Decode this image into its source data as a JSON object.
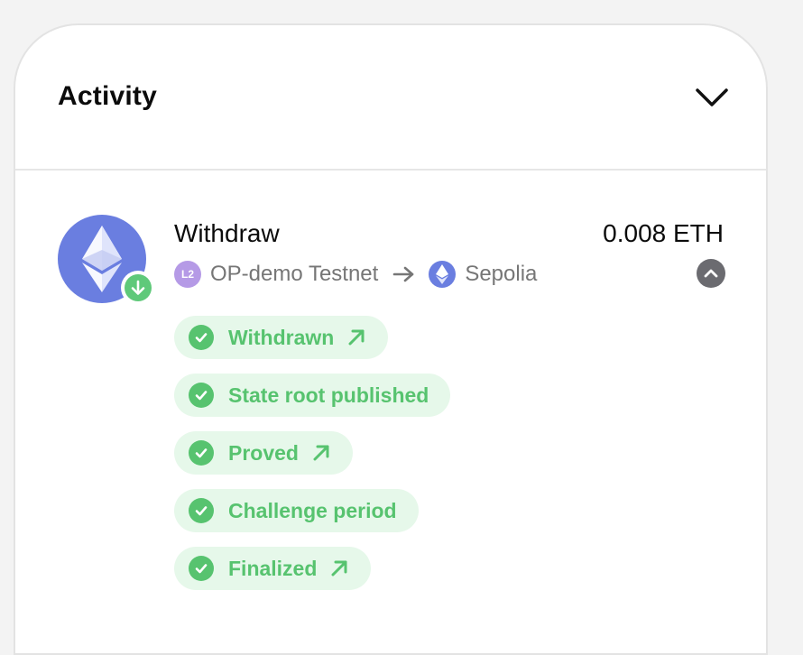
{
  "header": {
    "title": "Activity",
    "collapse_icon": "chevron-down-icon"
  },
  "transaction": {
    "type": "Withdraw",
    "amount": "0.008 ETH",
    "token_icon": "ethereum-icon",
    "direction_icon": "arrow-down-icon",
    "from_chain": "OP-demo Testnet",
    "from_chain_icon_text": "L2",
    "to_chain": "Sepolia",
    "route_arrow_icon": "arrow-right-icon",
    "expand_icon": "chevron-up-icon",
    "steps": [
      {
        "label": "Withdrawn",
        "status": "complete",
        "has_link": true
      },
      {
        "label": "State root published",
        "status": "complete",
        "has_link": false
      },
      {
        "label": "Proved",
        "status": "complete",
        "has_link": true
      },
      {
        "label": "Challenge period",
        "status": "complete",
        "has_link": false
      },
      {
        "label": "Finalized",
        "status": "complete",
        "has_link": true
      }
    ]
  },
  "colors": {
    "accent_green": "#57c36f",
    "step_bg": "#e6f8ea",
    "eth_blue": "#6a7ee0",
    "l2_purple": "#b59ae6",
    "muted_text": "#767676"
  }
}
